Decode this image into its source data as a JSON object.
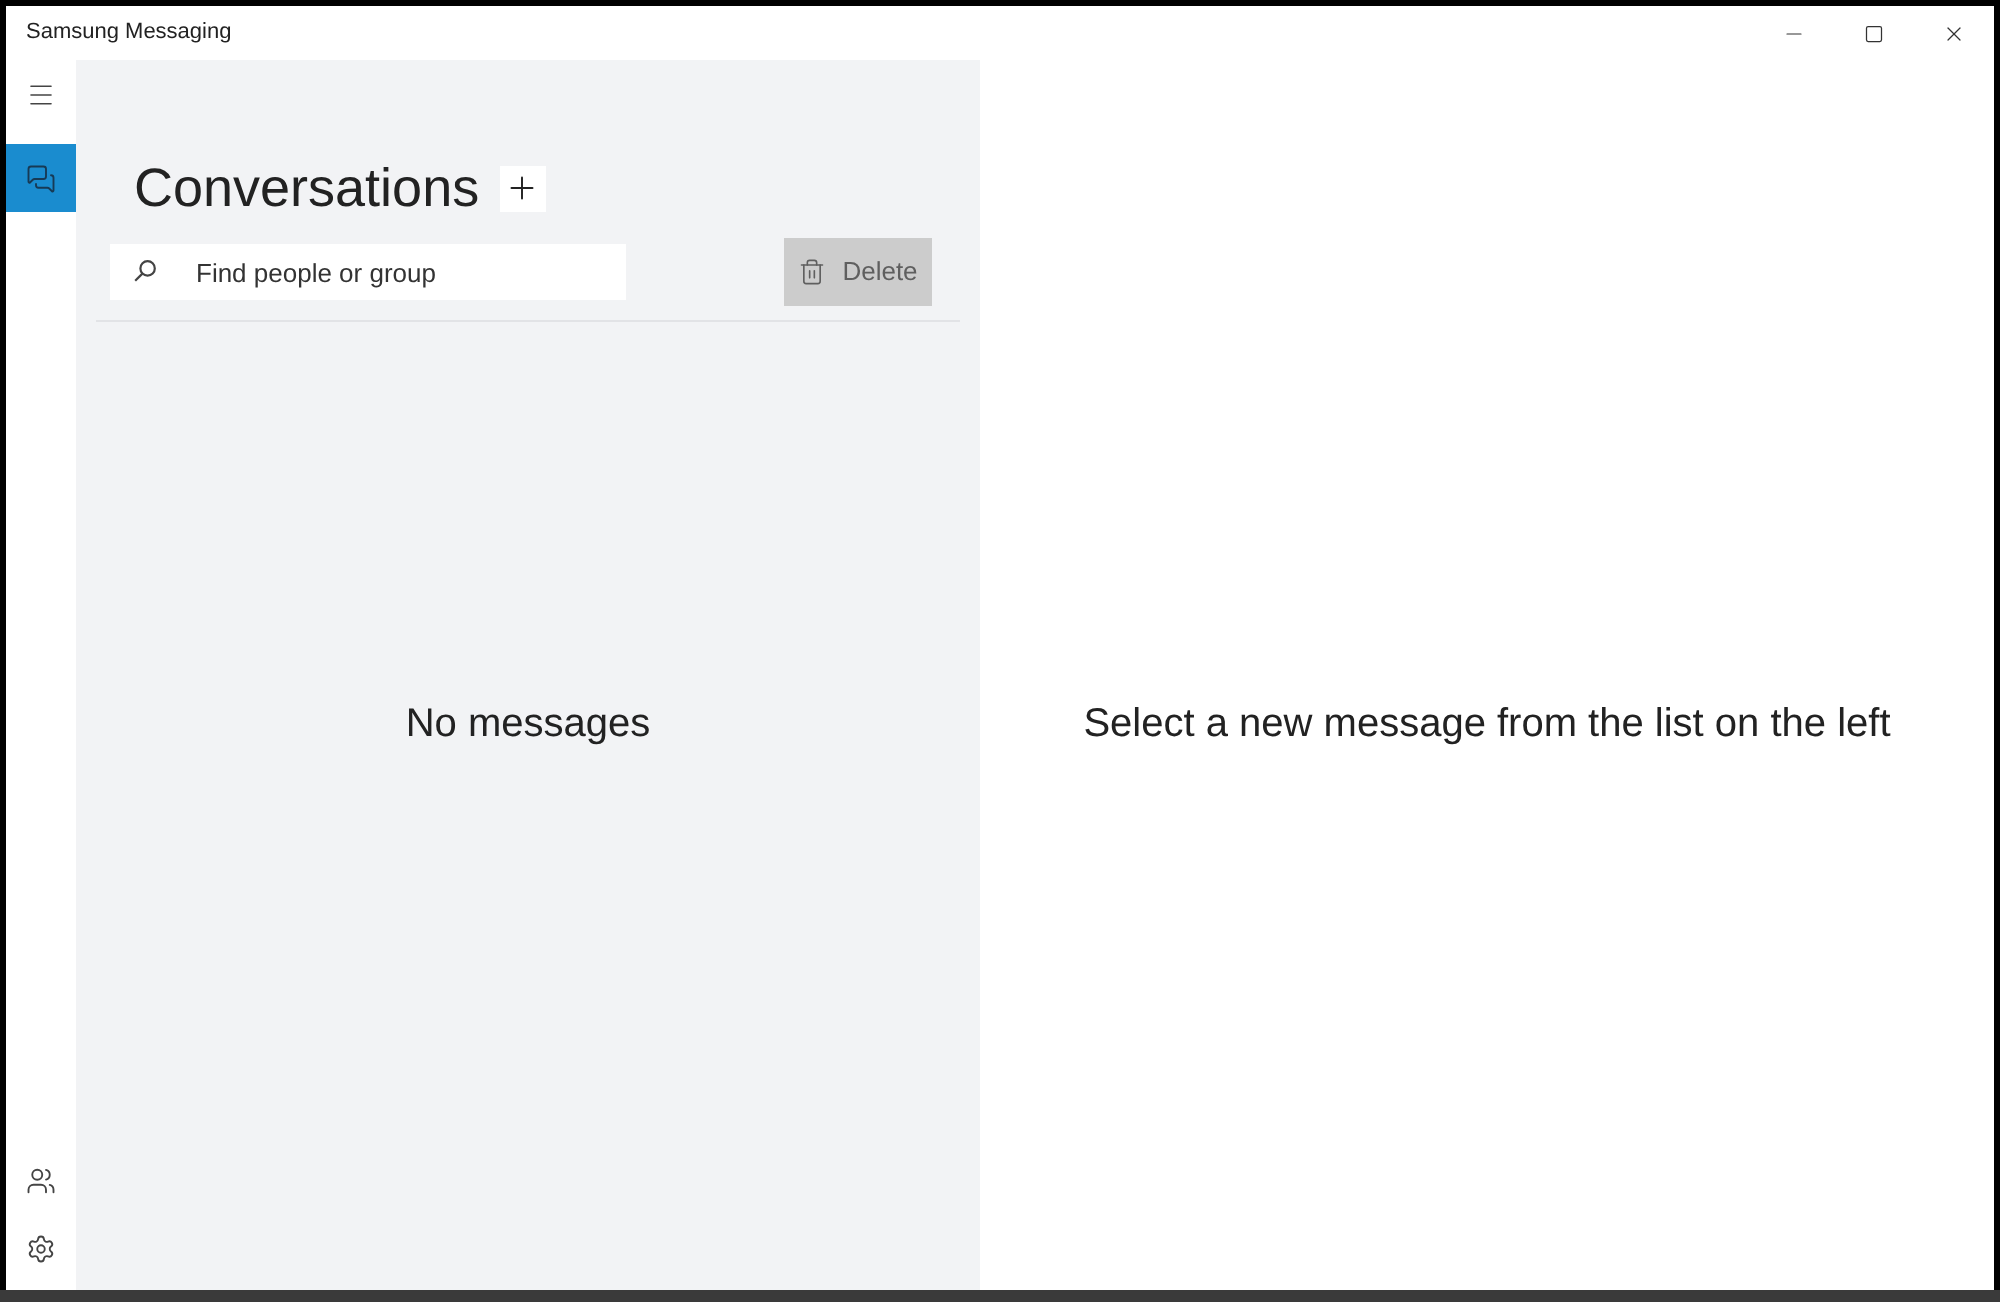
{
  "window": {
    "title": "Samsung Messaging"
  },
  "nav_rail": {
    "top_items": [
      {
        "kind": "conversations",
        "selected": true
      }
    ],
    "bottom_items": [
      {
        "kind": "contacts",
        "selected": false
      },
      {
        "kind": "settings",
        "selected": false
      }
    ]
  },
  "conversations_panel": {
    "title": "Conversations",
    "search": {
      "placeholder": "Find people or group"
    },
    "delete_button": {
      "label": "Delete",
      "disabled": true
    },
    "empty_message": "No messages"
  },
  "detail_pane": {
    "message": "Select a new message from the list on the left"
  }
}
